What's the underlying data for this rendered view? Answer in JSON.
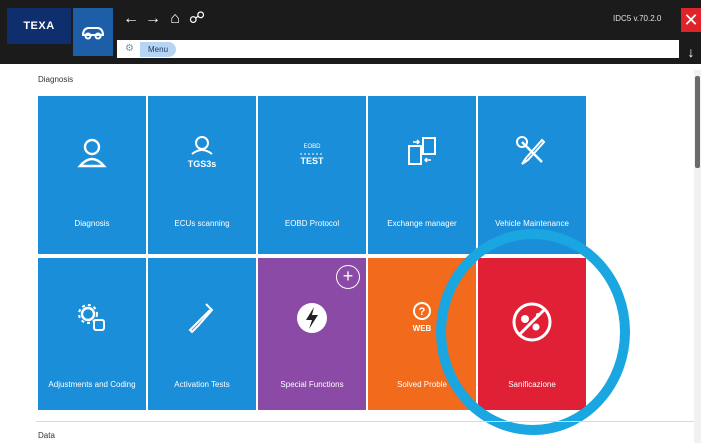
{
  "app": {
    "logo_text": "TEXA",
    "version": "IDC5 v.70.2.0",
    "breadcrumb": "Menu"
  },
  "colors": {
    "topbar": "#1b1b1b",
    "tile_blue": "#1a8ed8",
    "tile_purple": "#8a4aa6",
    "tile_orange": "#f26a1b",
    "tile_red": "#e02035",
    "highlight_ring": "#1aa6e0"
  },
  "sections": {
    "diagnosis": "Diagnosis",
    "data": "Data"
  },
  "tiles": [
    {
      "label": "Diagnosis",
      "icon": "diagnosis-magnifier-icon",
      "color": "#1a8ed8"
    },
    {
      "label": "ECUs scanning",
      "icon": "tgs3s-scan-icon",
      "color": "#1a8ed8"
    },
    {
      "label": "EOBD Protocol",
      "icon": "eobd-test-icon",
      "color": "#1a8ed8"
    },
    {
      "label": "Exchange manager",
      "icon": "exchange-manager-icon",
      "color": "#1a8ed8"
    },
    {
      "label": "Vehicle Maintenance",
      "icon": "wrench-screwdriver-icon",
      "color": "#1a8ed8"
    },
    {
      "label": "Adjustments and Coding",
      "icon": "gears-icon",
      "color": "#1a8ed8"
    },
    {
      "label": "Activation Tests",
      "icon": "activation-probe-icon",
      "color": "#1a8ed8"
    },
    {
      "label": "Special Functions",
      "icon": "lightning-bolt-icon",
      "color": "#8a4aa6"
    },
    {
      "label": "Solved Proble",
      "icon": "web-question-icon",
      "color": "#f26a1b"
    },
    {
      "label": "Sanificazione",
      "icon": "no-virus-icon",
      "color": "#e02035"
    }
  ],
  "add_badge": "+",
  "icon_texts": {
    "tgs": "TGS3s",
    "eobd_top": "EOBD",
    "eobd_test": "TEST",
    "web": "WEB"
  }
}
